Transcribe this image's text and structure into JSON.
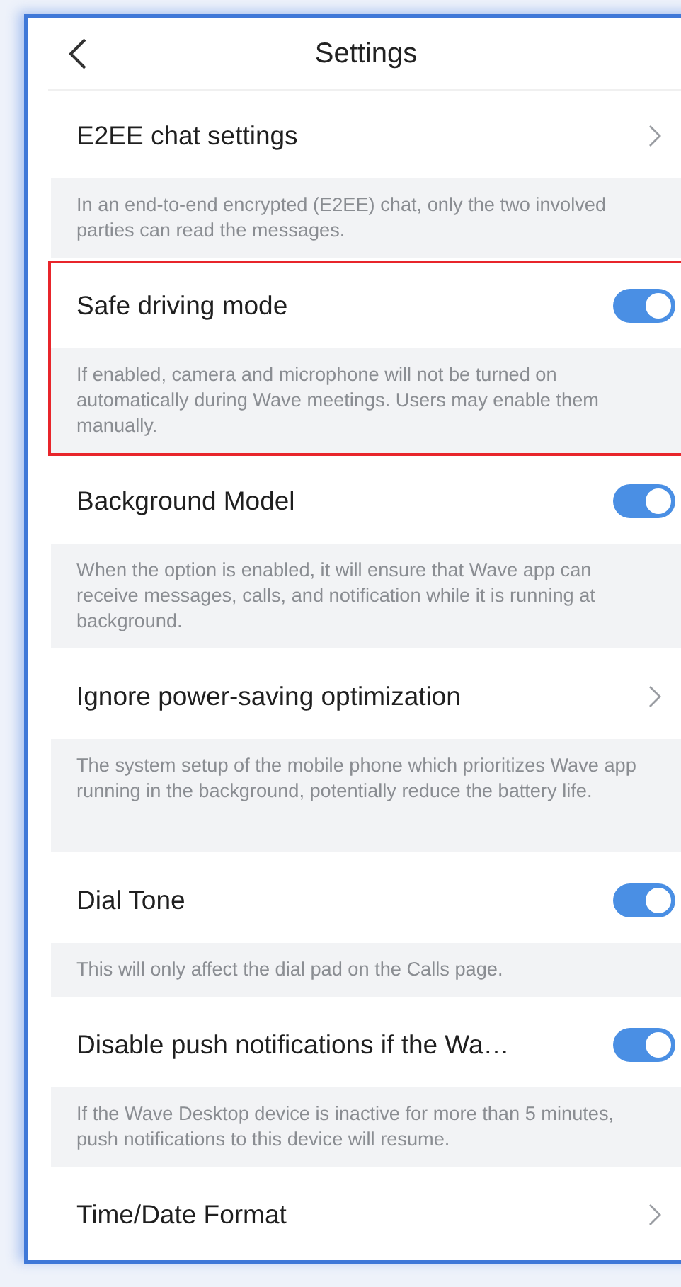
{
  "header": {
    "title": "Settings"
  },
  "items": [
    {
      "kind": "link",
      "title": "E2EE chat settings",
      "description": "In an end-to-end encrypted (E2EE) chat, only the two involved parties can read the messages.",
      "highlighted": false
    },
    {
      "kind": "toggle",
      "title": "Safe driving mode",
      "on": true,
      "description": "If enabled, camera and microphone will not be turned on automatically during Wave meetings. Users may enable them manually.",
      "highlighted": true
    },
    {
      "kind": "toggle",
      "title": "Background Model",
      "on": true,
      "description": "When the option is enabled, it will ensure that Wave app can receive messages, calls, and notification while it is running at background.",
      "highlighted": false
    },
    {
      "kind": "link",
      "title": "Ignore power-saving optimization",
      "description": "The system setup of the mobile phone which prioritizes Wave app running in the background, potentially reduce the battery life.",
      "highlighted": false
    },
    {
      "kind": "toggle",
      "title": "Dial Tone",
      "on": true,
      "description": "This will only affect the dial pad on the Calls page.",
      "highlighted": false
    },
    {
      "kind": "toggle",
      "title": "Disable push notifications if the Wa…",
      "on": true,
      "description": "If the Wave Desktop device is inactive for more than 5 minutes, push notifications to this device will resume.",
      "highlighted": false
    },
    {
      "kind": "link",
      "title": "Time/Date Format",
      "highlighted": false
    }
  ]
}
